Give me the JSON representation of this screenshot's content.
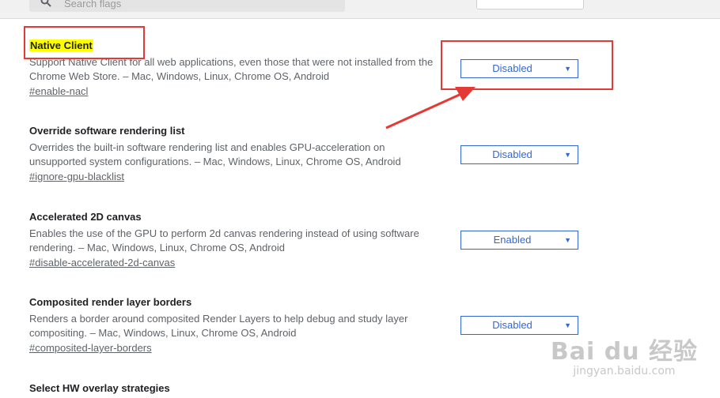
{
  "search": {
    "placeholder": "Search flags"
  },
  "flags": [
    {
      "name": "Native Client",
      "desc": "Support Native Client for all web applications, even those that were not installed from the Chrome Web Store. – Mac, Windows, Linux, Chrome OS, Android",
      "link": "#enable-nacl",
      "value": "Disabled"
    },
    {
      "name": "Override software rendering list",
      "desc": "Overrides the built-in software rendering list and enables GPU-acceleration on unsupported system configurations. – Mac, Windows, Linux, Chrome OS, Android",
      "link": "#ignore-gpu-blacklist",
      "value": "Disabled"
    },
    {
      "name": "Accelerated 2D canvas",
      "desc": "Enables the use of the GPU to perform 2d canvas rendering instead of using software rendering. – Mac, Windows, Linux, Chrome OS, Android",
      "link": "#disable-accelerated-2d-canvas",
      "value": "Enabled"
    },
    {
      "name": "Composited render layer borders",
      "desc": "Renders a border around composited Render Layers to help debug and study layer compositing. – Mac, Windows, Linux, Chrome OS, Android",
      "link": "#composited-layer-borders",
      "value": "Disabled"
    },
    {
      "name": "Select HW overlay strategies"
    }
  ],
  "annotation": {
    "color": "#e53935"
  },
  "highlight_color": "#ffff00",
  "accent": "#3367d6",
  "watermark": {
    "logo": "Bai du 经验",
    "site": "jingyan.baidu.com"
  }
}
